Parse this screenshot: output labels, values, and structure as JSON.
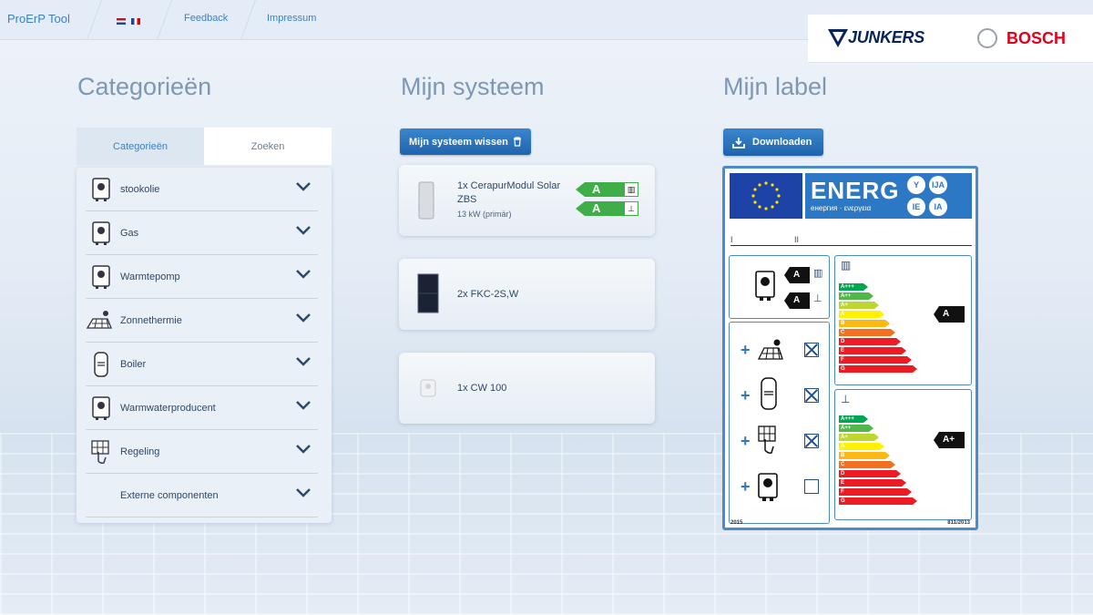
{
  "topbar": {
    "app_title": "ProErP Tool",
    "links": [
      "Feedback",
      "Impressum"
    ]
  },
  "brands": {
    "junkers": "JUNKERS",
    "bosch": "BOSCH"
  },
  "columns": {
    "categories_title": "Categorieën",
    "system_title": "Mijn systeem",
    "label_title": "Mijn label"
  },
  "tabs": [
    {
      "label": "Categorieën",
      "active": true
    },
    {
      "label": "Zoeken",
      "active": false
    }
  ],
  "categories": [
    {
      "label": "stookolie",
      "icon": "boiler-icon"
    },
    {
      "label": "Gas",
      "icon": "boiler-icon"
    },
    {
      "label": "Warmtepomp",
      "icon": "boiler-icon"
    },
    {
      "label": "Zonnethermie",
      "icon": "solar-panel-icon"
    },
    {
      "label": "Boiler",
      "icon": "tank-icon"
    },
    {
      "label": "Warmwaterproducent",
      "icon": "boiler-icon"
    },
    {
      "label": "Regeling",
      "icon": "control-hand-icon"
    },
    {
      "label": "Externe componenten",
      "icon": ""
    }
  ],
  "system": {
    "clear_button": "Mijn systeem wissen",
    "items": [
      {
        "name": "1x CerapurModul Solar",
        "name2": "ZBS",
        "sub": "13 kW (primär)",
        "ratings": [
          "A",
          "A"
        ]
      },
      {
        "name": "2x FKC-2S,W"
      },
      {
        "name": "1x CW 100"
      }
    ]
  },
  "label": {
    "download_button": "Downloaden",
    "energ": "ENERG",
    "energ_sub": "енергия · ενεργεια",
    "langs": [
      "Y",
      "IJA",
      "IE",
      "IA"
    ],
    "roman": [
      "I",
      "II"
    ],
    "heat_rating": "A",
    "water_rating": "A+",
    "product_heat": "A",
    "product_water": "A",
    "scale": [
      "A+++",
      "A++",
      "A+",
      "A",
      "B",
      "C",
      "D",
      "E",
      "F",
      "G"
    ],
    "year": "2015",
    "regulation": "811/2013"
  },
  "colors": {
    "accent": "#3d7fc1",
    "button": "#1f64ad",
    "rating_green": "#3fae49",
    "scale": [
      "#00a650",
      "#50b848",
      "#bed630",
      "#fff200",
      "#fdb913",
      "#f37021",
      "#ed1c24",
      "#ed1c24",
      "#ed1c24",
      "#ed1c24"
    ]
  }
}
